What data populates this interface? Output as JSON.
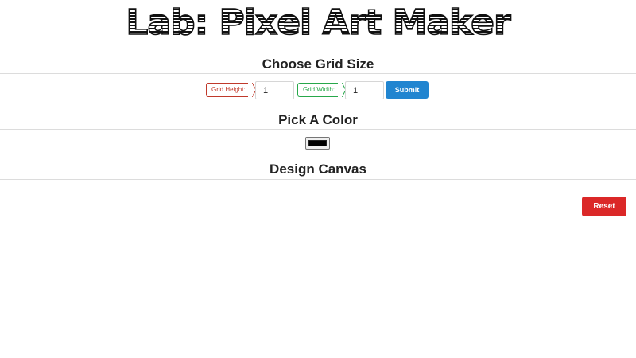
{
  "title": "Lab: Pixel Art Maker",
  "sections": {
    "grid_size_heading": "Choose Grid Size",
    "color_heading": "Pick A Color",
    "canvas_heading": "Design Canvas"
  },
  "grid_form": {
    "height_label": "Grid Height:",
    "height_value": "1",
    "width_label": "Grid Width:",
    "width_value": "1",
    "submit_label": "Submit"
  },
  "color_picker": {
    "value": "#000000"
  },
  "reset_label": "Reset",
  "colors": {
    "submit": "#2185d0",
    "reset": "#db2828",
    "height_tag": "#c0392b",
    "width_tag": "#27a84a"
  }
}
